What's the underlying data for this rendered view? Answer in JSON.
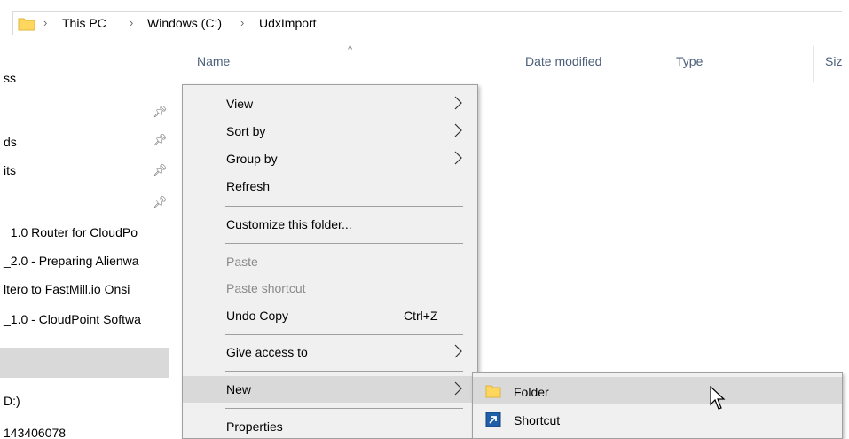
{
  "breadcrumb": {
    "items": [
      "This PC",
      "Windows (C:)",
      "UdxImport"
    ],
    "separator": "›"
  },
  "nav": {
    "items": [
      "ss",
      "",
      "ds",
      "its",
      "",
      "_1.0 Router for CloudPo",
      "_2.0 - Preparing Alienwa",
      "ltero to FastMill.io Onsi",
      "_1.0 - CloudPoint Softwa",
      "",
      "D:)",
      "143406078"
    ]
  },
  "columns": {
    "name": "Name",
    "date_modified": "Date modified",
    "type": "Type",
    "size": "Siz"
  },
  "context_menu": {
    "view": "View",
    "sort_by": "Sort by",
    "group_by": "Group by",
    "refresh": "Refresh",
    "customize": "Customize this folder...",
    "paste": "Paste",
    "paste_shortcut": "Paste shortcut",
    "undo_copy": "Undo Copy",
    "undo_copy_accel": "Ctrl+Z",
    "give_access": "Give access to",
    "new": "New",
    "properties": "Properties"
  },
  "new_submenu": {
    "folder": "Folder",
    "shortcut": "Shortcut"
  },
  "colors": {
    "folder_yellow": "#ffd75e",
    "menu_bg": "#f0f0f0",
    "hover_bg": "#d9d9d9",
    "header_text": "#4c607a",
    "shortcut_blue": "#1f5fa8"
  }
}
